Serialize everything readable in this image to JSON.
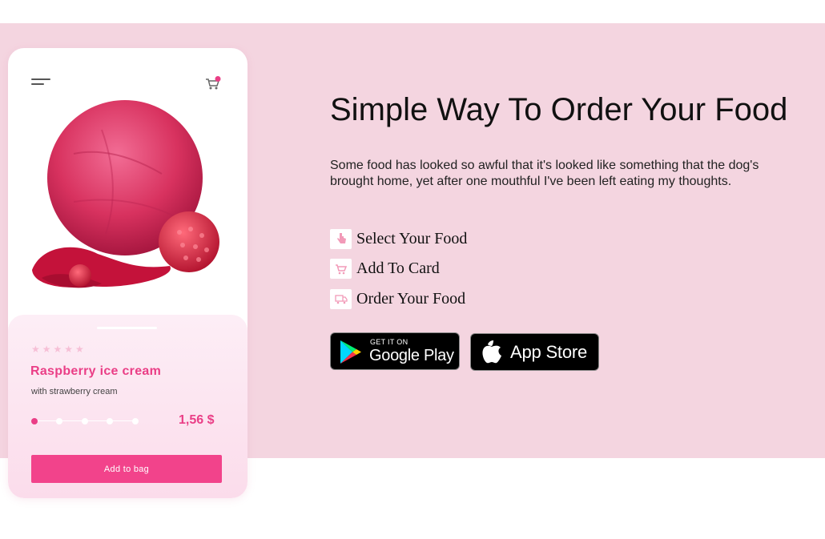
{
  "product_card": {
    "rating_stars": "★★★★★",
    "name": "Raspberry ice cream",
    "subtitle": "with strawberry cream",
    "price": "1,56 $",
    "add_button_label": "Add to bag"
  },
  "hero": {
    "headline": "Simple Way To Order Your Food",
    "description": "Some food has looked so awful that it's looked like something that the dog's brought home, yet after one mouthful I've been left eating my thoughts.",
    "steps": [
      {
        "icon": "hand-pointer-icon",
        "label": "Select Your Food"
      },
      {
        "icon": "cart-icon",
        "label": "Add To Card"
      },
      {
        "icon": "delivery-icon",
        "label": "Order Your Food"
      }
    ]
  },
  "store_buttons": {
    "google_play": {
      "small": "GET IT ON",
      "big": "Google Play"
    },
    "app_store": {
      "big": "App Store"
    }
  },
  "colors": {
    "band_bg": "#f4d5e0",
    "accent_pink": "#ea3e86",
    "button_pink": "#f2438b"
  }
}
